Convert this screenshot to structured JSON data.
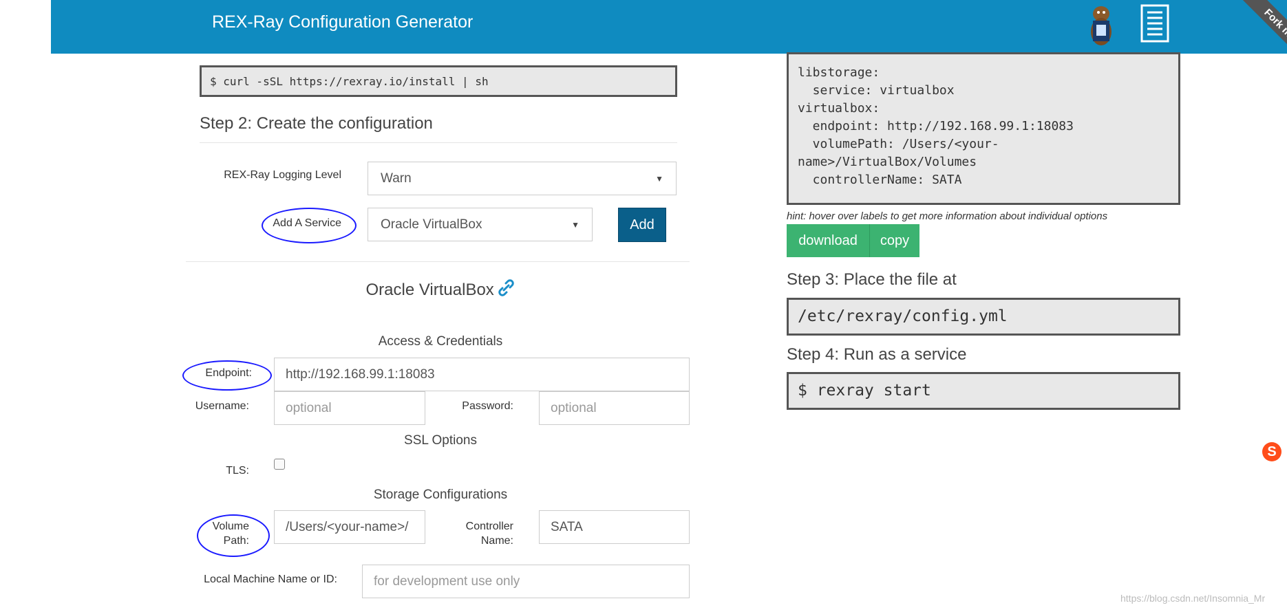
{
  "header": {
    "title": "REX-Ray Configuration Generator",
    "ribbon": "Fork me"
  },
  "step1": {
    "install_cmd": "$ curl -sSL https://rexray.io/install | sh"
  },
  "step2": {
    "heading": "Step 2: Create the configuration",
    "logging_label": "REX-Ray Logging Level",
    "logging_value": "Warn",
    "service_label": "Add A Service",
    "service_value": "Oracle VirtualBox",
    "add_button": "Add"
  },
  "service": {
    "title": "Oracle VirtualBox",
    "access_heading": "Access & Credentials",
    "endpoint_label": "Endpoint:",
    "endpoint_value": "http://192.168.99.1:18083",
    "username_label": "Username:",
    "username_placeholder": "optional",
    "password_label": "Password:",
    "password_placeholder": "optional",
    "ssl_heading": "SSL Options",
    "tls_label": "TLS:",
    "storage_heading": "Storage Configurations",
    "volume_label_1": "Volume",
    "volume_label_2": "Path:",
    "volume_value": "/Users/<your-name>/",
    "controller_label_1": "Controller",
    "controller_label_2": "Name:",
    "controller_value": "SATA",
    "localname_label": "Local Machine Name or ID:",
    "localname_placeholder": "for development use only"
  },
  "output": {
    "config_text": "libstorage:\n  service: virtualbox\nvirtualbox:\n  endpoint: http://192.168.99.1:18083\n  volumePath: /Users/<your-\nname>/VirtualBox/Volumes\n  controllerName: SATA",
    "hint": "hint: hover over labels to get more information about individual options",
    "download_button": "download",
    "copy_button": "copy",
    "step3_heading": "Step 3: Place the file at",
    "step3_path": "/etc/rexray/config.yml",
    "step4_heading": "Step 4: Run as a service",
    "step4_cmd": "$ rexray start"
  },
  "watermark": "https://blog.csdn.net/Insomnia_Mr",
  "colors": {
    "topbar": "#0f8bc0",
    "add_button": "#0a5f8a",
    "green_button": "#3cb371",
    "annotation": "#1a1aff"
  }
}
